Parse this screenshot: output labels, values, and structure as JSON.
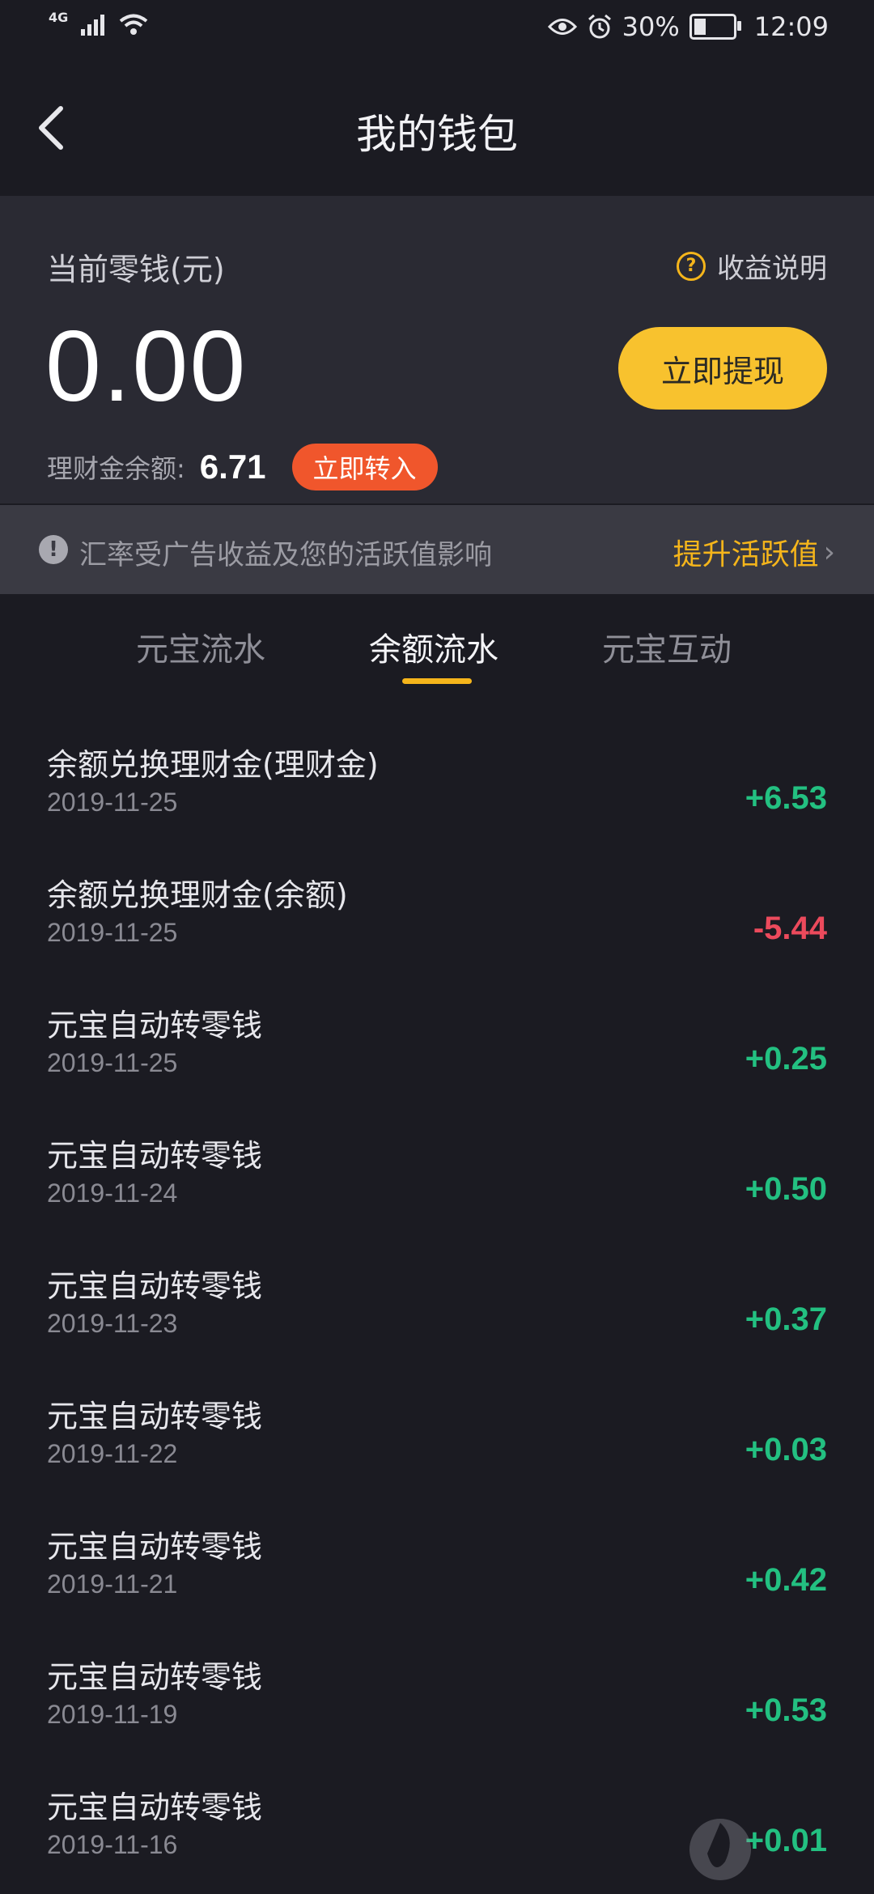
{
  "status_bar": {
    "network": "4G",
    "battery": "30%",
    "time": "12:09"
  },
  "header": {
    "title": "我的钱包"
  },
  "balance_card": {
    "label": "当前零钱(元)",
    "help_label": "收益说明",
    "amount": "0.00",
    "withdraw_label": "立即提现",
    "fund_label": "理财金余额:",
    "fund_value": "6.71",
    "transfer_label": "立即转入"
  },
  "notice": {
    "text": "汇率受广告收益及您的活跃值影响",
    "link": "提升活跃值"
  },
  "tabs": [
    {
      "label": "元宝流水"
    },
    {
      "label": "余额流水"
    },
    {
      "label": "元宝互动"
    }
  ],
  "transactions": [
    {
      "title": "余额兑换理财金(理财金)",
      "date": "2019-11-25",
      "amount": "+6.53"
    },
    {
      "title": "余额兑换理财金(余额)",
      "date": "2019-11-25",
      "amount": "-5.44"
    },
    {
      "title": "元宝自动转零钱",
      "date": "2019-11-25",
      "amount": "+0.25"
    },
    {
      "title": "元宝自动转零钱",
      "date": "2019-11-24",
      "amount": "+0.50"
    },
    {
      "title": "元宝自动转零钱",
      "date": "2019-11-23",
      "amount": "+0.37"
    },
    {
      "title": "元宝自动转零钱",
      "date": "2019-11-22",
      "amount": "+0.03"
    },
    {
      "title": "元宝自动转零钱",
      "date": "2019-11-21",
      "amount": "+0.42"
    },
    {
      "title": "元宝自动转零钱",
      "date": "2019-11-19",
      "amount": "+0.53"
    },
    {
      "title": "元宝自动转零钱",
      "date": "2019-11-16",
      "amount": "+0.01"
    }
  ],
  "colors": {
    "positive": "#23c081",
    "negative": "#ec4a5c",
    "accent": "#f5b51b"
  }
}
